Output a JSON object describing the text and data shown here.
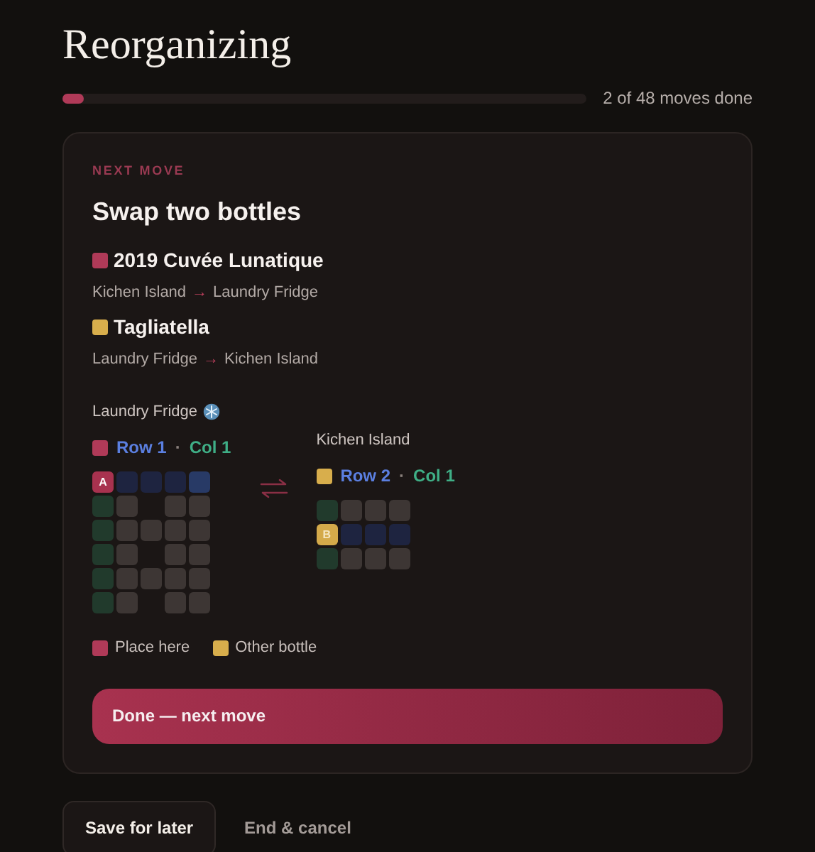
{
  "title": "Reorganizing",
  "progress": {
    "level": 0.04,
    "label": "2 of 48 moves done"
  },
  "card": {
    "eyebrow": "NEXT MOVE",
    "heading": "Swap two bottles",
    "bottles": [
      {
        "name": "2019 Cuvée Lunatique",
        "color": "#b03a58",
        "from": "Kichen Island",
        "arrow": "→",
        "to": "Laundry Fridge"
      },
      {
        "name": "Tagliatella",
        "color": "#d8ae4c",
        "from": "Laundry Fridge",
        "arrow": "→",
        "to": "Kichen Island"
      }
    ],
    "racks": [
      {
        "name": "Laundry Fridge",
        "cold": true,
        "color": "#b03a58",
        "row": "Row 1",
        "sep": "·",
        "col": "Col 1",
        "cells": [
          [
            {
              "kind": "target",
              "label": "A"
            },
            {
              "kind": "navy"
            },
            {
              "kind": "navy"
            },
            {
              "kind": "navy"
            },
            {
              "kind": "blue"
            }
          ],
          [
            {
              "kind": "green"
            },
            {
              "kind": "gray"
            },
            {
              "kind": "empty"
            },
            {
              "kind": "gray"
            },
            {
              "kind": "gray"
            }
          ],
          [
            {
              "kind": "green"
            },
            {
              "kind": "gray"
            },
            {
              "kind": "gray"
            },
            {
              "kind": "gray"
            },
            {
              "kind": "gray"
            }
          ],
          [
            {
              "kind": "green"
            },
            {
              "kind": "gray"
            },
            {
              "kind": "empty"
            },
            {
              "kind": "gray"
            },
            {
              "kind": "gray"
            }
          ],
          [
            {
              "kind": "green"
            },
            {
              "kind": "gray"
            },
            {
              "kind": "gray"
            },
            {
              "kind": "gray"
            },
            {
              "kind": "gray"
            }
          ],
          [
            {
              "kind": "green"
            },
            {
              "kind": "gray"
            },
            {
              "kind": "empty"
            },
            {
              "kind": "gray"
            },
            {
              "kind": "gray"
            }
          ]
        ]
      },
      {
        "name": "Kichen Island",
        "cold": false,
        "color": "#d8ae4c",
        "row": "Row 2",
        "sep": "·",
        "col": "Col 1",
        "cells": [
          [
            {
              "kind": "green"
            },
            {
              "kind": "gray"
            },
            {
              "kind": "gray"
            },
            {
              "kind": "gray"
            }
          ],
          [
            {
              "kind": "other",
              "label": "B"
            },
            {
              "kind": "navy"
            },
            {
              "kind": "navy"
            },
            {
              "kind": "navy"
            }
          ],
          [
            {
              "kind": "green"
            },
            {
              "kind": "gray"
            },
            {
              "kind": "gray"
            },
            {
              "kind": "gray"
            }
          ]
        ]
      }
    ],
    "legend": [
      {
        "label": "Place here",
        "color": "#b03a58"
      },
      {
        "label": "Other bottle",
        "color": "#d8ae4c"
      }
    ],
    "primary_button": "Done — next move"
  },
  "actions": {
    "save": "Save for later",
    "cancel": "End & cancel"
  }
}
